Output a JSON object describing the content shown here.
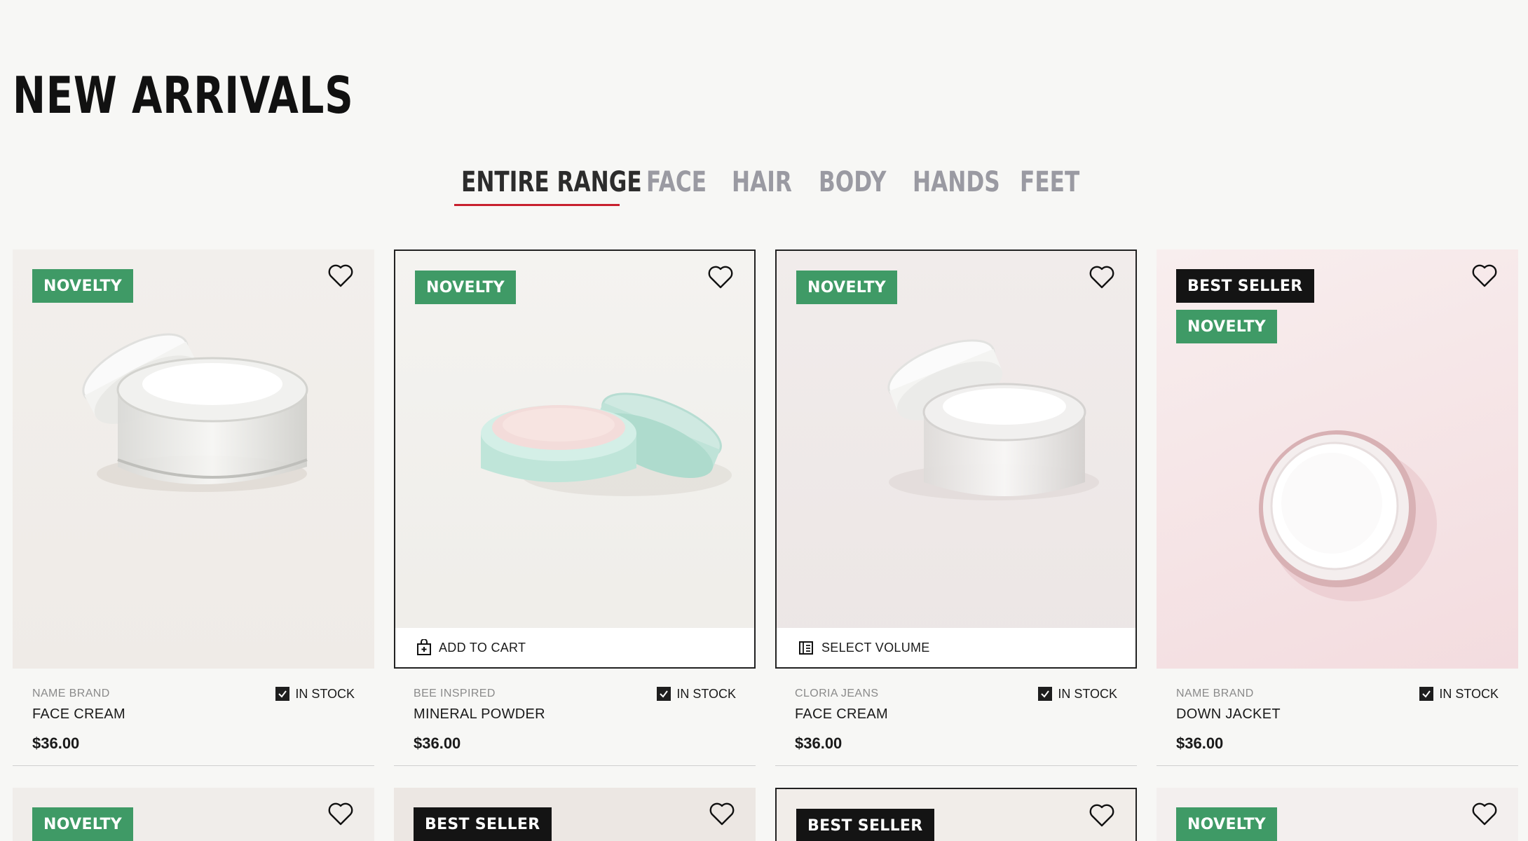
{
  "page_title": "NEW ARRIVALS",
  "tabs": [
    {
      "label": "ENTIRE RANGE",
      "active": true
    },
    {
      "label": "FACE",
      "active": false
    },
    {
      "label": "HAIR",
      "active": false
    },
    {
      "label": "BODY",
      "active": false
    },
    {
      "label": "HANDS",
      "active": false
    },
    {
      "label": "FEET",
      "active": false
    }
  ],
  "colors": {
    "novelty_badge": "#3f9a66",
    "best_seller_badge": "#141414",
    "active_tab_underline": "#c8202e"
  },
  "products": [
    {
      "badges": [
        "NOVELTY"
      ],
      "brand": "NAME BRAND",
      "stock": "IN STOCK",
      "name": "FACE CREAM",
      "price": "$36.00",
      "image": "open-cream-jar-icon"
    },
    {
      "badges": [
        "NOVELTY"
      ],
      "brand": "BEE INSPIRED",
      "stock": "IN STOCK",
      "name": "MINERAL POWDER",
      "price": "$36.00",
      "action": "ADD TO CART",
      "image": "mint-powder-jar-icon"
    },
    {
      "badges": [
        "NOVELTY"
      ],
      "brand": "CLORIA JEANS",
      "stock": "IN STOCK",
      "name": "FACE CREAM",
      "price": "$36.00",
      "action": "SELECT VOLUME",
      "image": "open-cream-jar-icon"
    },
    {
      "badges": [
        "BEST SELLER",
        "NOVELTY"
      ],
      "brand": "NAME BRAND",
      "stock": "IN STOCK",
      "name": "DOWN JACKET",
      "price": "$36.00",
      "image": "cream-jar-top-view-icon"
    }
  ],
  "next_row_badges": [
    "NOVELTY",
    "BEST SELLER",
    "BEST SELLER",
    "NOVELTY"
  ]
}
